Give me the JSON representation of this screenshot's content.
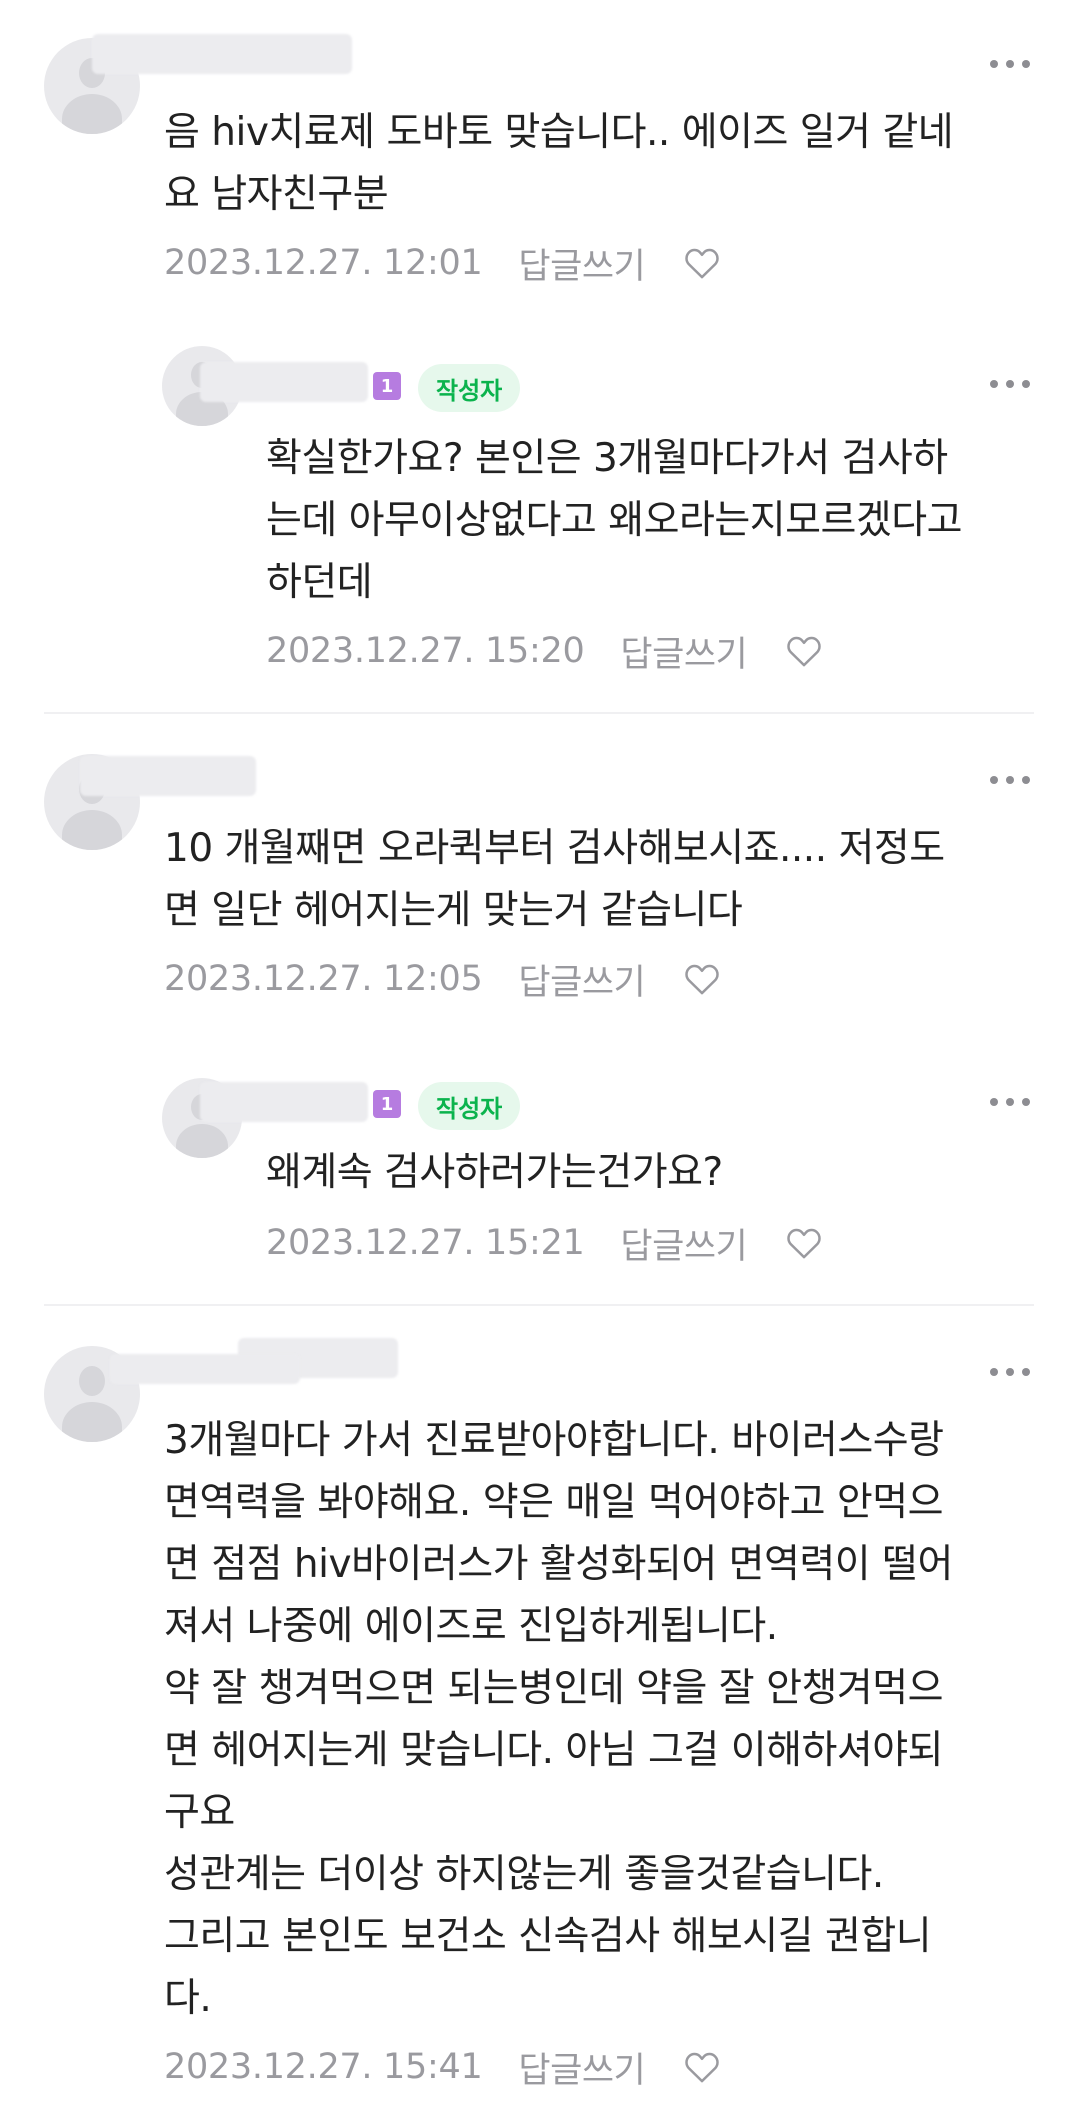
{
  "comments": [
    {
      "text": "음 hiv치료제 도바토 맞습니다.. 에이즈 일거 같네\n요 남자친구분",
      "date": "2023.12.27. 12:01",
      "reply_label": "답글쓰기",
      "more_label": "more-options"
    },
    {
      "is_author": true,
      "level": "1",
      "author_badge": "작성자",
      "text": "확실한가요? 본인은 3개월마다가서 검사하\n는데 아무이상없다고 왜오라는지모르겠다고\n하던데",
      "date": "2023.12.27. 15:20",
      "reply_label": "답글쓰기"
    },
    {
      "text": "10 개월째면 오라퀵부터 검사해보시죠.... 저정도\n면 일단 헤어지는게 맞는거 같습니다",
      "date": "2023.12.27. 12:05",
      "reply_label": "답글쓰기"
    },
    {
      "is_author": true,
      "level": "1",
      "author_badge": "작성자",
      "text": "왜계속 검사하러가는건가요?",
      "date": "2023.12.27. 15:21",
      "reply_label": "답글쓰기"
    },
    {
      "text": "3개월마다 가서 진료받아야합니다. 바이러스수랑\n면역력을 봐야해요. 약은 매일 먹어야하고 안먹으\n면 점점 hiv바이러스가 활성화되어 면역력이 떨어\n져서 나중에 에이즈로 진입하게됩니다.\n약 잘 챙겨먹으면 되는병인데 약을 잘 안챙겨먹으\n면 헤어지는게 맞습니다. 아님 그걸 이해하셔야되\n구요\n성관계는 더이상 하지않는게 좋을것같습니다.\n그리고 본인도 보건소 신속검사 해보시길 권합니\n다.",
      "date": "2023.12.27. 15:41",
      "reply_label": "답글쓰기"
    }
  ],
  "colors": {
    "text": "#222222",
    "meta": "#9a9a9f",
    "author_badge_bg": "#e6f8ec",
    "author_badge_fg": "#0bb34d",
    "level_badge": "#b67ce0"
  },
  "icons": {
    "more": "more-options-icon",
    "like": "heart-outline-icon",
    "avatar": "default-avatar-icon"
  }
}
